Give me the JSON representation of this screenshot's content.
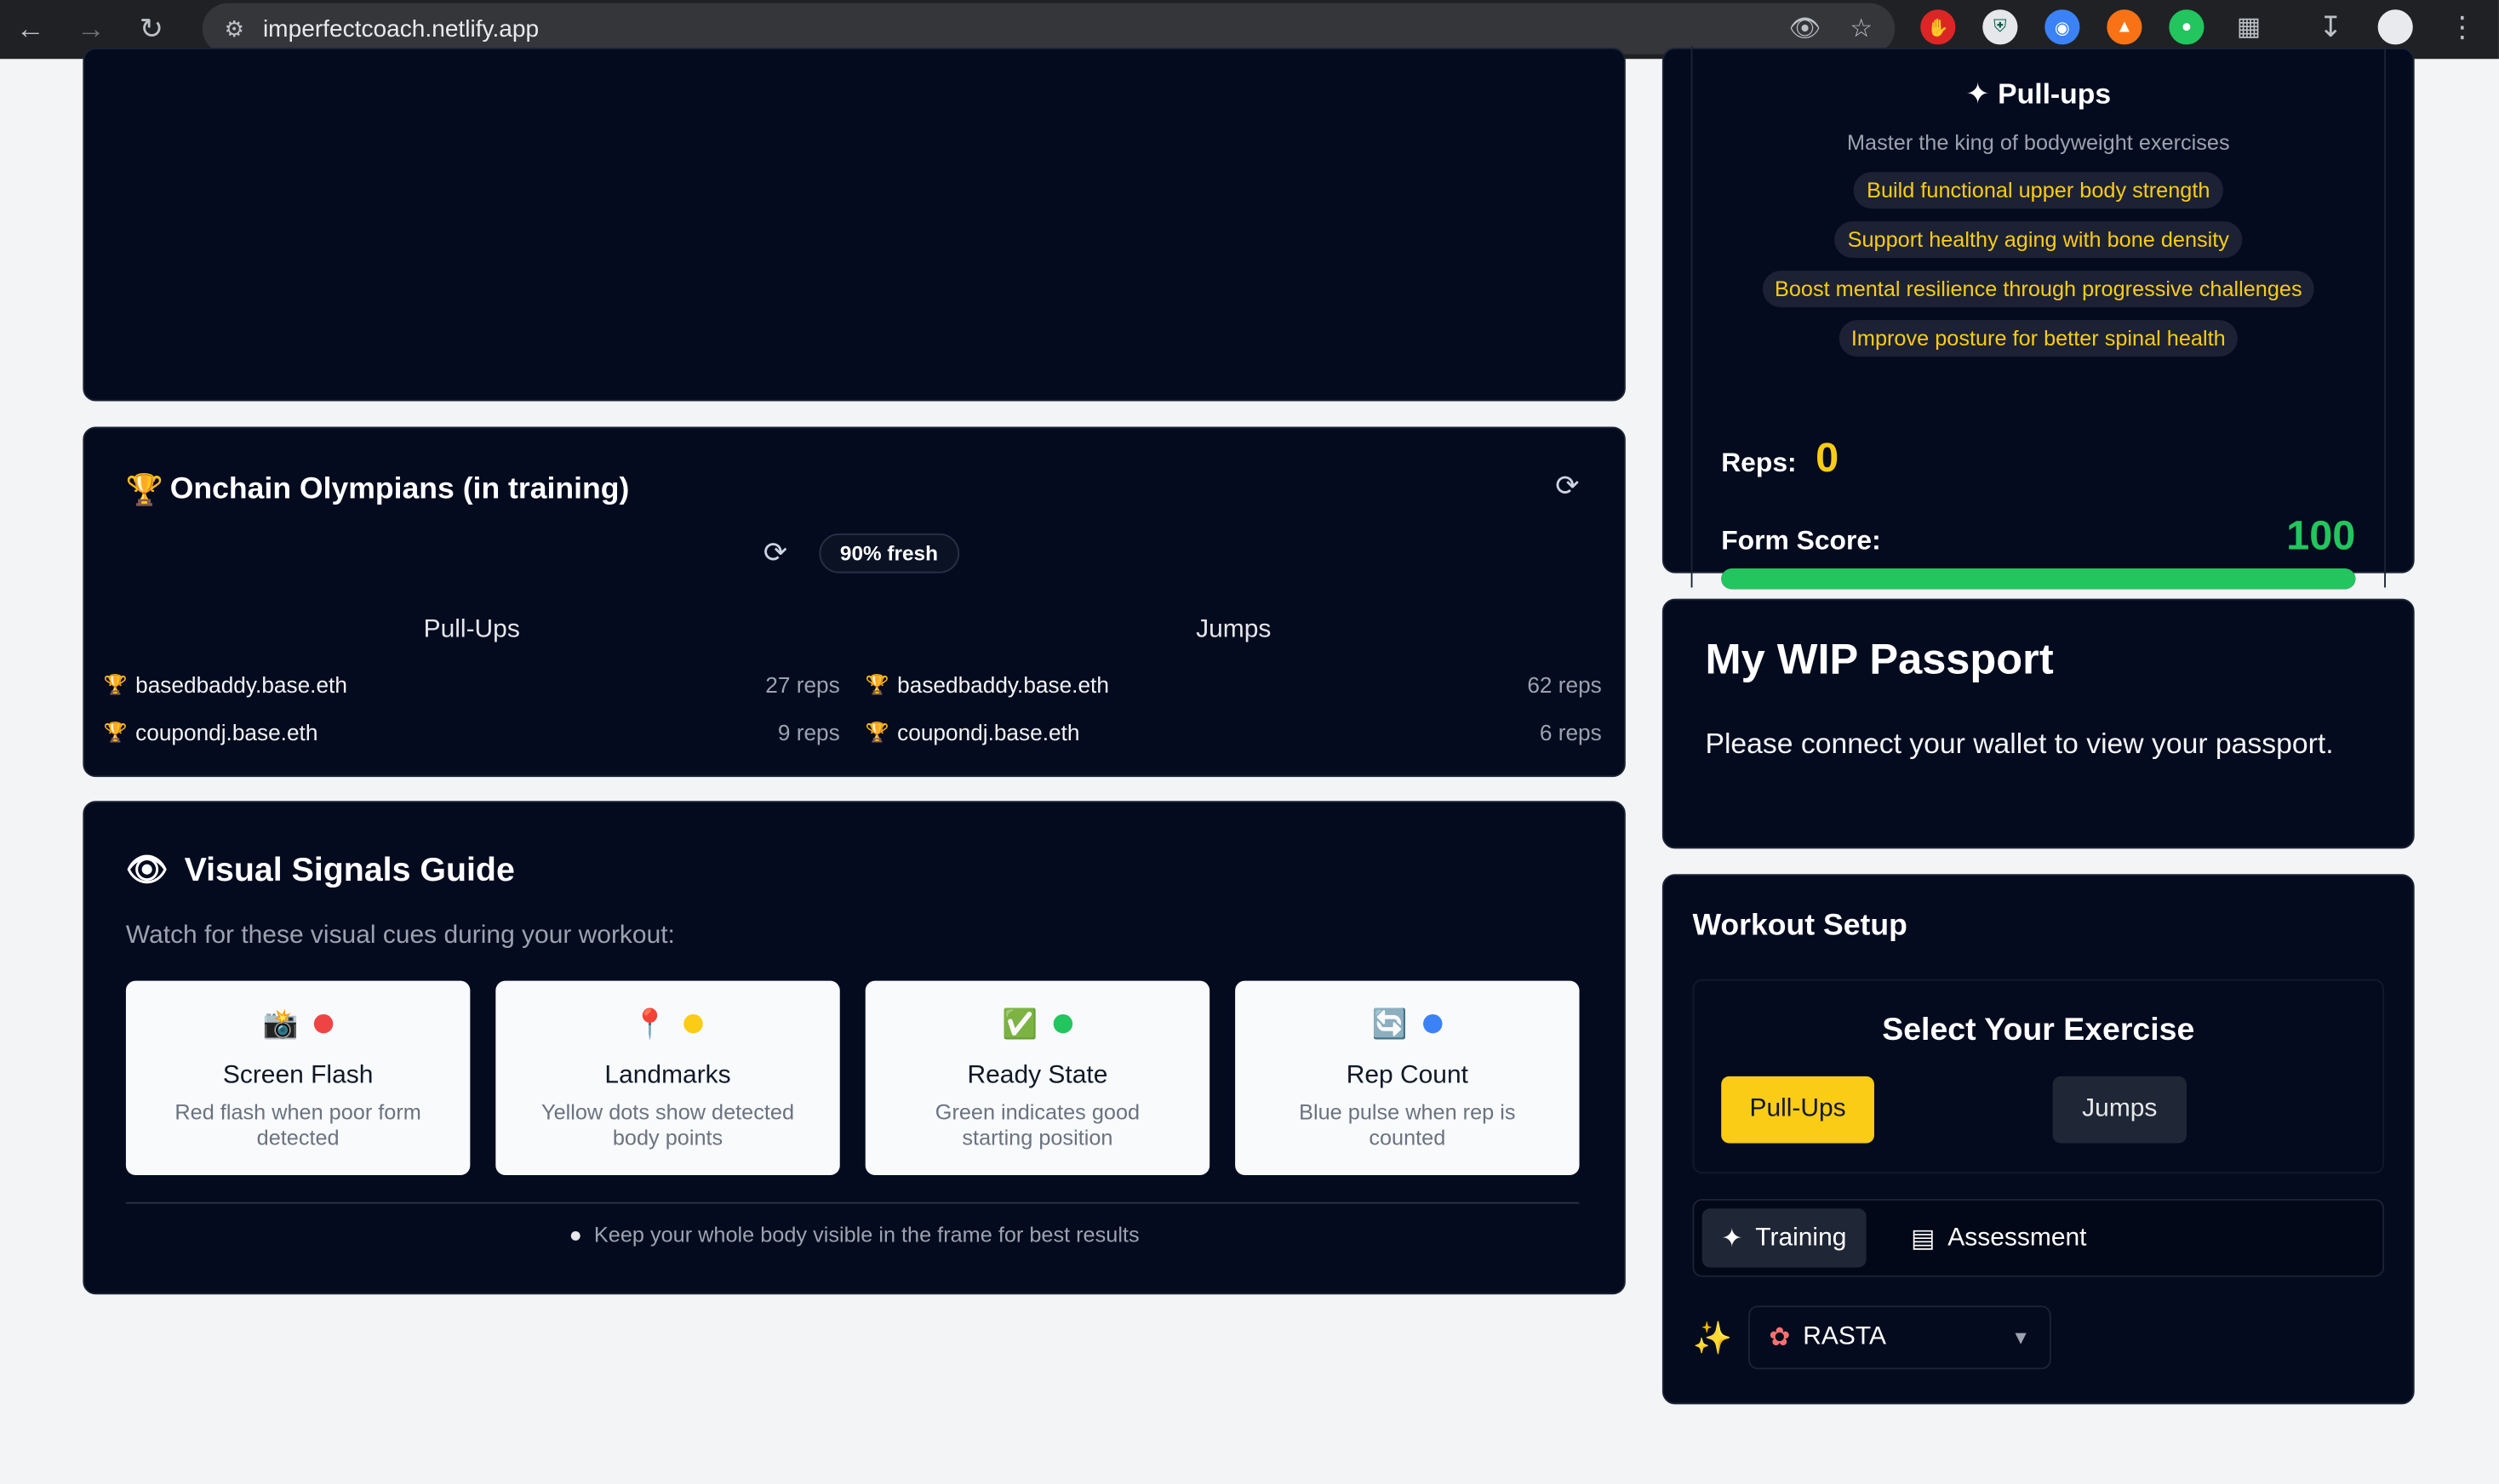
{
  "browser": {
    "url": "imperfectcoach.netlify.app"
  },
  "exercise_info": {
    "title": "Pull-ups",
    "subtitle": "Master the king of bodyweight exercises",
    "benefits": [
      "Build functional upper body strength",
      "Support healthy aging with bone density",
      "Boost mental resilience through progressive challenges",
      "Improve posture for better spinal health"
    ],
    "reps_label": "Reps:",
    "reps_value": "0",
    "form_label": "Form Score:",
    "form_value": "100",
    "form_progress_percent": 100,
    "colors": {
      "accent": "#facc15",
      "good": "#22c55e"
    }
  },
  "leaderboard": {
    "title": "Onchain Olympians (in training)",
    "title_icon": "trophy-icon",
    "freshness": "90% fresh",
    "columns": [
      {
        "heading": "Pull-Ups",
        "entries": [
          {
            "name": "basedbaddy.base.eth",
            "reps": "27 reps",
            "rank": "gold"
          },
          {
            "name": "coupondj.base.eth",
            "reps": "9 reps",
            "rank": "silver"
          }
        ]
      },
      {
        "heading": "Jumps",
        "entries": [
          {
            "name": "basedbaddy.base.eth",
            "reps": "62 reps",
            "rank": "gold"
          },
          {
            "name": "coupondj.base.eth",
            "reps": "6 reps",
            "rank": "silver"
          }
        ]
      }
    ]
  },
  "guide": {
    "title": "Visual Signals Guide",
    "subtitle": "Watch for these visual cues during your workout:",
    "cards": [
      {
        "emoji": "📸",
        "dot_color": "#ef4444",
        "title": "Screen Flash",
        "desc": "Red flash when poor form detected"
      },
      {
        "emoji": "📍",
        "dot_color": "#facc15",
        "title": "Landmarks",
        "desc": "Yellow dots show detected body points"
      },
      {
        "emoji": "✅",
        "dot_color": "#22c55e",
        "title": "Ready State",
        "desc": "Green indicates good starting position"
      },
      {
        "emoji": "🔄",
        "dot_color": "#3b82f6",
        "title": "Rep Count",
        "desc": "Blue pulse when rep is counted"
      }
    ],
    "tip": "Keep your whole body visible in the frame for best results"
  },
  "passport": {
    "title": "My WIP Passport",
    "message": "Please connect your wallet to view your passport."
  },
  "setup": {
    "title": "Workout Setup",
    "select_heading": "Select Your Exercise",
    "exercises": [
      "Pull-Ups",
      "Jumps"
    ],
    "selected_exercise": "Pull-Ups",
    "modes": [
      "Training",
      "Assessment"
    ],
    "selected_mode": "Training",
    "coach_personality": "RASTA"
  }
}
